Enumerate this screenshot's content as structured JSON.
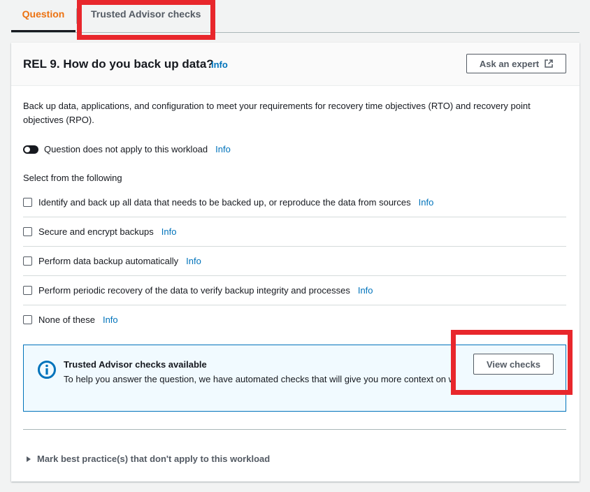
{
  "tabs": {
    "question": "Question",
    "trusted_advisor": "Trusted Advisor checks"
  },
  "header": {
    "title": "REL 9. How do you back up data?",
    "info": "Info",
    "ask_expert": "Ask an expert"
  },
  "description": "Back up data, applications, and configuration to meet your requirements for recovery time objectives (RTO) and recovery point objectives (RPO).",
  "toggle": {
    "label": "Question does not apply to this workload",
    "info": "Info",
    "state": "off"
  },
  "select_label": "Select from the following",
  "options": [
    {
      "label": "Identify and back up all data that needs to be backed up, or reproduce the data from sources",
      "info": "Info",
      "checked": false
    },
    {
      "label": "Secure and encrypt backups",
      "info": "Info",
      "checked": false
    },
    {
      "label": "Perform data backup automatically",
      "info": "Info",
      "checked": false
    },
    {
      "label": "Perform periodic recovery of the data to verify backup integrity and processes",
      "info": "Info",
      "checked": false
    },
    {
      "label": "None of these",
      "info": "Info",
      "checked": false
    }
  ],
  "alert": {
    "icon": "info-circle-icon",
    "title": "Trusted Advisor checks available",
    "text": "To help you answer the question, we have automated checks that will give you more context on what you have in your account.",
    "button": "View checks"
  },
  "expander": "Mark best practice(s) that don't apply to this workload",
  "colors": {
    "accent": "#ec7211",
    "link": "#0073bb",
    "highlight": "#e8272c",
    "alert_bg": "#f1faff"
  }
}
